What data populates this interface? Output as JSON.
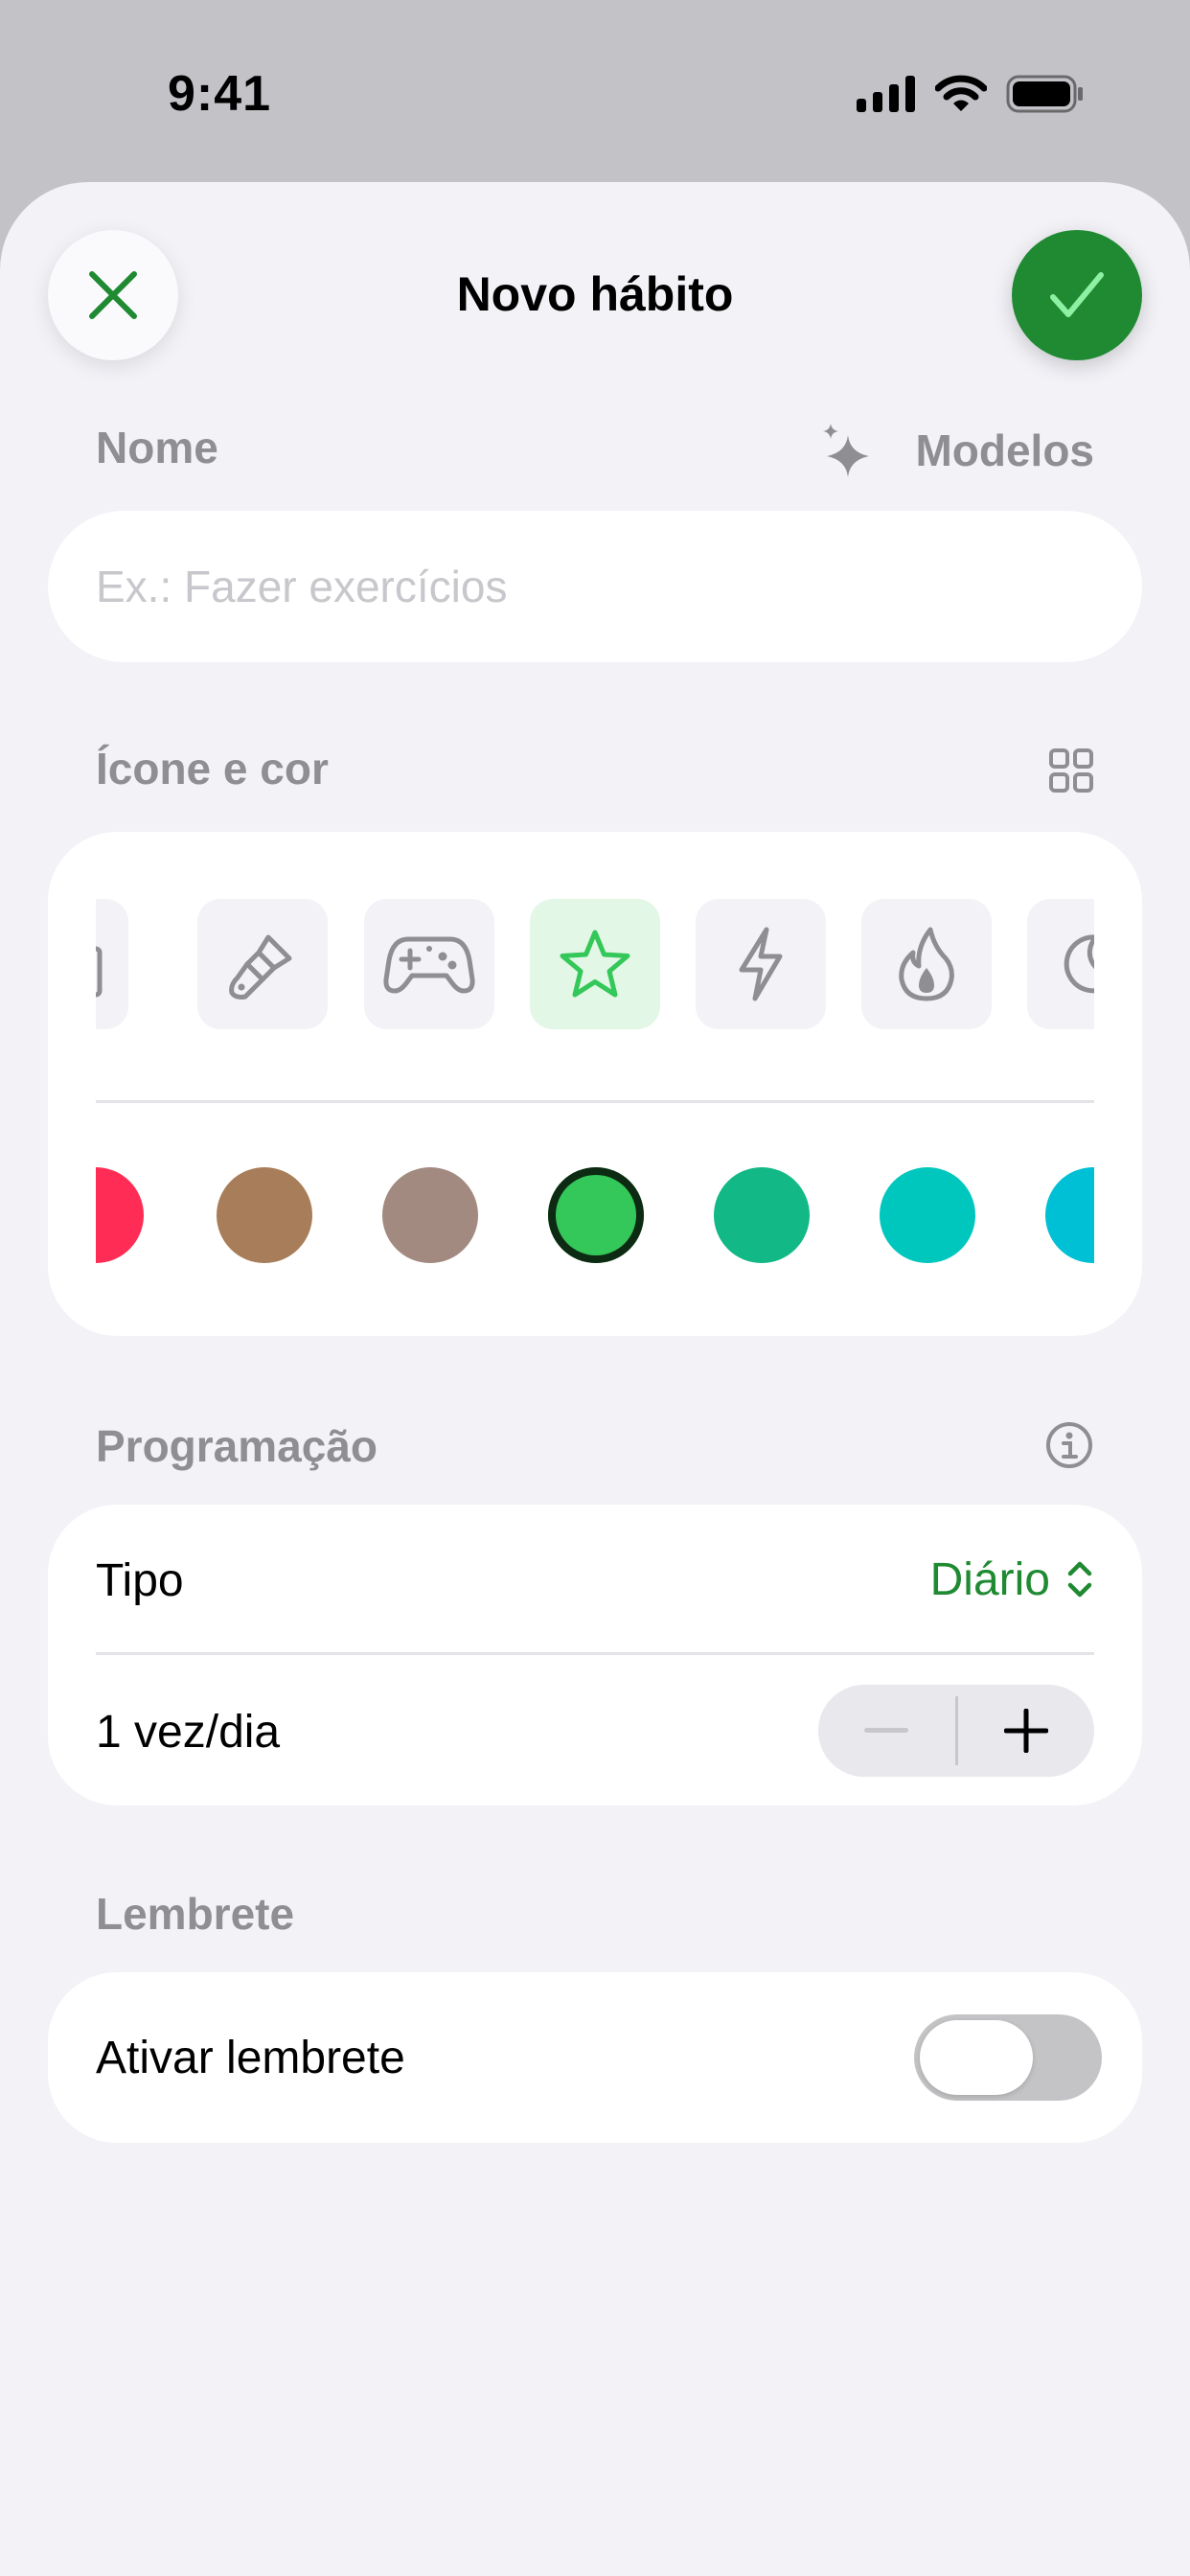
{
  "status_bar": {
    "time": "9:41",
    "icons": [
      "cellular-signal-icon",
      "wifi-icon",
      "battery-icon"
    ]
  },
  "header": {
    "title": "Novo hábito",
    "close_icon": "close-icon",
    "confirm_icon": "checkmark-icon"
  },
  "name_section": {
    "label": "Nome",
    "templates_label": "Modelos",
    "templates_icon": "sparkles-icon",
    "placeholder": "Ex.: Fazer exercícios",
    "value": ""
  },
  "icon_section": {
    "label": "Ícone e cor",
    "grid_icon": "grid-icon",
    "icons": [
      "camera-icon",
      "paintbrush-icon",
      "gamepad-icon",
      "star-icon",
      "bolt-icon",
      "flame-icon",
      "moon-icon"
    ],
    "selected_icon": "star-icon",
    "colors": [
      "#ff2d55",
      "#a87e5a",
      "#a38a80",
      "#34c759",
      "#12b886",
      "#00c7be",
      "#00c0d6"
    ],
    "selected_color": "#34c759"
  },
  "schedule_section": {
    "label": "Programação",
    "info_icon": "info-icon",
    "type_label": "Tipo",
    "type_value": "Diário",
    "frequency_label": "1 vez/dia",
    "accent_color": "#1f8a32"
  },
  "reminder_section": {
    "label": "Lembrete",
    "toggle_label": "Ativar lembrete",
    "toggle_on": false
  }
}
